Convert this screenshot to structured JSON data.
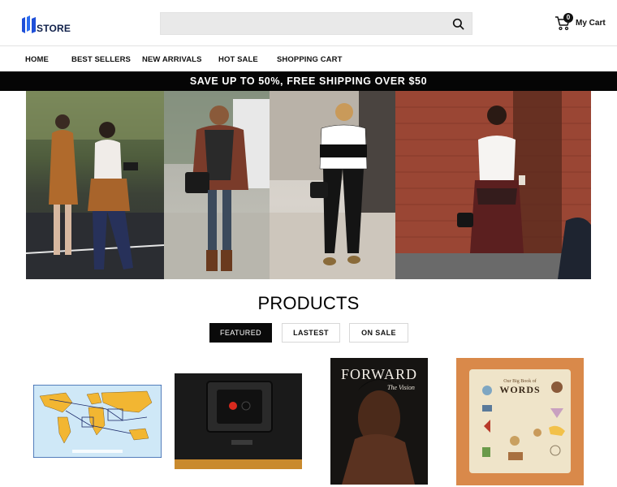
{
  "header": {
    "logo_text": "STORE",
    "search": {
      "placeholder": ""
    },
    "cart": {
      "count": "0",
      "label": "My Cart"
    }
  },
  "nav": {
    "items": [
      {
        "label": "HOME"
      },
      {
        "label": "BEST SELLERS"
      },
      {
        "label": "NEW ARRIVALS"
      },
      {
        "label": "HOT SALE"
      },
      {
        "label": "SHOPPING CART"
      }
    ]
  },
  "promo": {
    "text": "SAVE UP TO 50%, FREE SHIPPING OVER $50"
  },
  "products": {
    "title": "PRODUCTS",
    "tabs": [
      {
        "label": "FEATURED",
        "active": true
      },
      {
        "label": "LASTEST",
        "active": false
      },
      {
        "label": "ON SALE",
        "active": false
      }
    ],
    "items": [
      {
        "image": "world-map-chart"
      },
      {
        "image": "speaker-terminal"
      },
      {
        "image": "magazine-cover",
        "cover_title": "FORWARD",
        "cover_subtitle": "The Vision"
      },
      {
        "image": "book-cover",
        "cover_title_small": "Our Big Book of",
        "cover_title": "WORDS"
      }
    ]
  },
  "colors": {
    "promo_bg": "#050505",
    "tab_active_bg": "#0a0a0a",
    "logo_blue": "#1f4fd8",
    "map_land": "#f2b632",
    "book_orange": "#d9894a"
  }
}
